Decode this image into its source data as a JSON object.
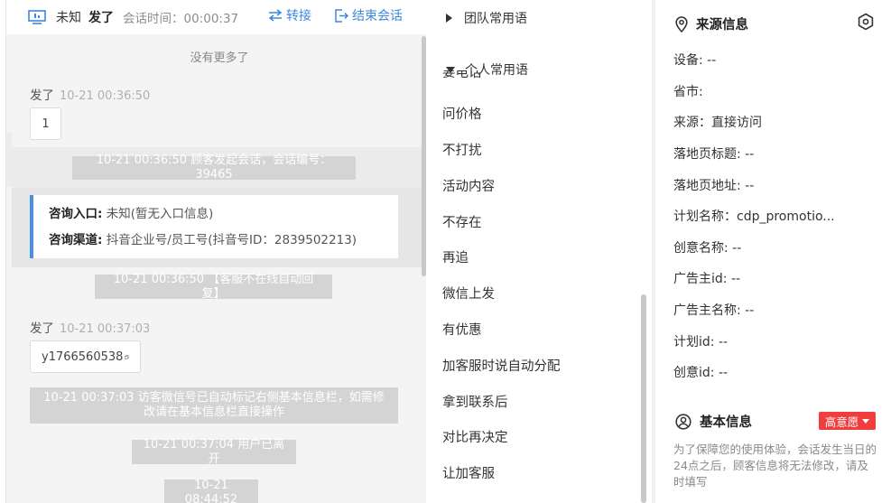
{
  "header": {
    "visitor_name": "未知",
    "visitor_name2": "发了",
    "session_time": "会话时间：00:00:37",
    "transfer_label": "转接",
    "end_label": "结束会话"
  },
  "chat": {
    "no_more": "没有更多了",
    "msg1": {
      "sender": "发了",
      "time": "10-21 00:36:50",
      "text": "1"
    },
    "sys1": "10-21 00:36:50 顾客发起会话，会话编号：39465",
    "card": {
      "entry_label": "咨询入口:",
      "entry_value": "未知(暂无入口信息)",
      "channel_label": "咨询渠道:",
      "channel_value": "抖音企业号/员工号(抖音号ID：2839502213)"
    },
    "sys2": "10-21 00:36:50 【客服不在线自动回复】",
    "msg2": {
      "sender": "发了",
      "time": "10-21 00:37:03",
      "text": "y1766560538"
    },
    "sys3": "10-21 00:37:03 访客微信号已自动标记右侧基本信息栏，如需修改请在基本信息栏直接操作",
    "sys4": "10-21 00:37:04 用户已离开",
    "sys5": "10-21 08:44:52"
  },
  "phrases": {
    "group_team": "团队常用语",
    "group_personal": "个人常用语",
    "partial_item": "要电话",
    "items": [
      "问价格",
      "不打扰",
      "活动内容",
      "不存在",
      "再追",
      "微信上发",
      "有优惠",
      "加客服时说自动分配",
      "拿到联系后",
      "对比再决定",
      "让加客服"
    ]
  },
  "info": {
    "source_title": "来源信息",
    "fields": [
      "设备: --",
      "省市:",
      "来源：直接访问",
      "落地页标题: --",
      "落地页地址: --",
      "计划名称：cdp_promotio...",
      "创意名称: --",
      "广告主id: --",
      "广告主名称: --",
      "计划id: --",
      "创意id: --"
    ],
    "basic_title": "基本信息",
    "intent_badge": "高意愿",
    "note": "为了保障您的使用体验，会话发生当日的24点之后，顾客信息将无法修改，请及时填写"
  },
  "colors": {
    "link": "#3e87e0",
    "card_accent": "#4a90e2",
    "badge": "#f03e3e"
  }
}
